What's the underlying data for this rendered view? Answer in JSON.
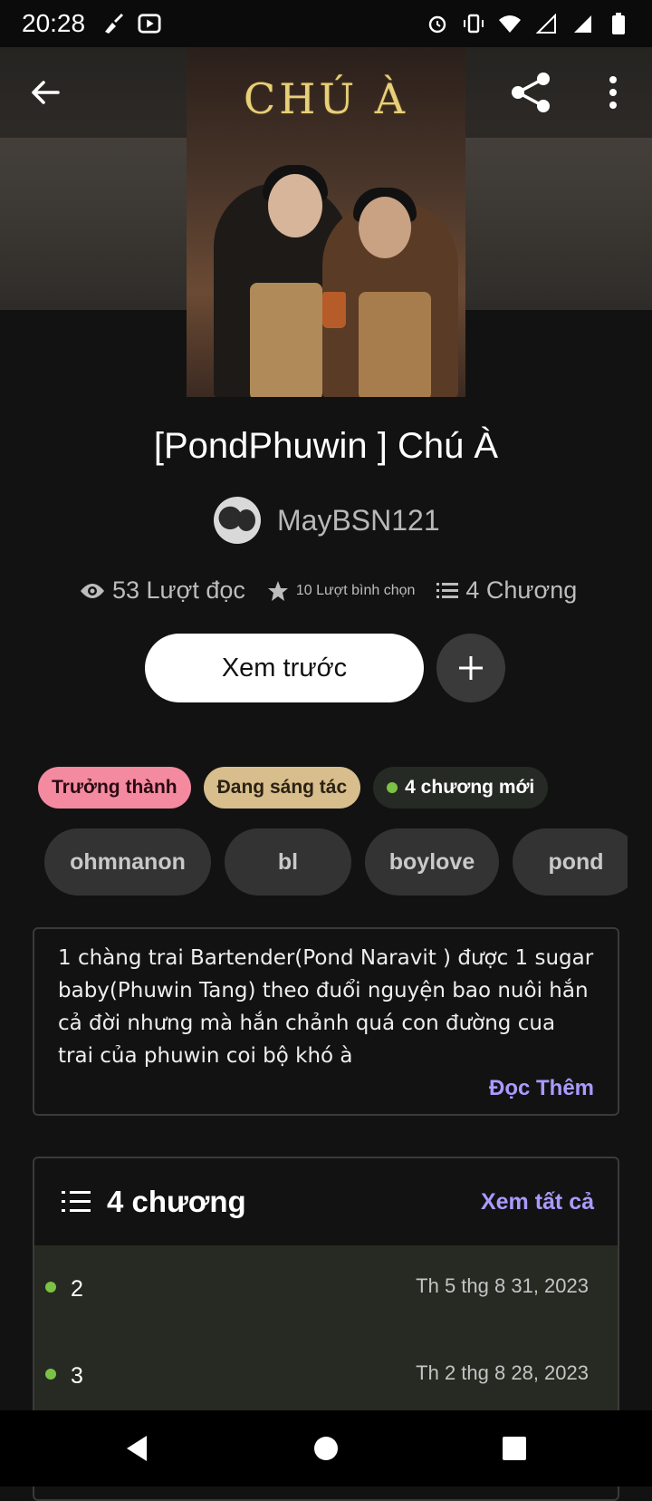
{
  "status_bar": {
    "time": "20:28",
    "left_icons": [
      "broom-icon",
      "youtube-icon"
    ],
    "right_icons": [
      "alarm-icon",
      "vibrate-icon",
      "wifi-icon",
      "signal-icon",
      "signal-icon",
      "battery-icon"
    ]
  },
  "toolbar": {
    "back_icon": "arrow-left-icon",
    "share_icon": "share-icon",
    "menu_icon": "more-vertical-icon"
  },
  "cover": {
    "title_text": "CHÚ À"
  },
  "story": {
    "title": "[PondPhuwin ] Chú À",
    "author": "MayBSN121",
    "reads": "53 Lượt đọc",
    "votes": "10 Lượt bình chọn",
    "parts": "4 Chương"
  },
  "actions": {
    "preview_label": "Xem trước",
    "add_icon": "plus-icon"
  },
  "badges": {
    "mature": "Trưởng thành",
    "ongoing": "Đang sáng tác",
    "new_chapters": "4 chương mới"
  },
  "tags": [
    "ohmnanon",
    "bl",
    "boylove",
    "pond"
  ],
  "description": {
    "text": "1 chàng trai Bartender(Pond Naravit ) được 1 sugar baby(Phuwin Tang) theo đuổi nguyện bao nuôi hắn cả đời nhưng mà hắn chảnh quá con đường cua trai của phuwin coi bộ khó à",
    "read_more": "Đọc Thêm"
  },
  "chapters": {
    "count_label": "4 chương",
    "see_all": "Xem tất cả",
    "items": [
      {
        "title": "2",
        "date": "Th 5 thg 8 31, 2023"
      },
      {
        "title": "3",
        "date": "Th 2 thg 8 28, 2023"
      }
    ]
  },
  "colors": {
    "background": "#121212",
    "accent_link": "#a99bff",
    "mature_badge": "#f48aa0",
    "ongoing_badge": "#d7be8c",
    "new_dot": "#7cc245"
  }
}
